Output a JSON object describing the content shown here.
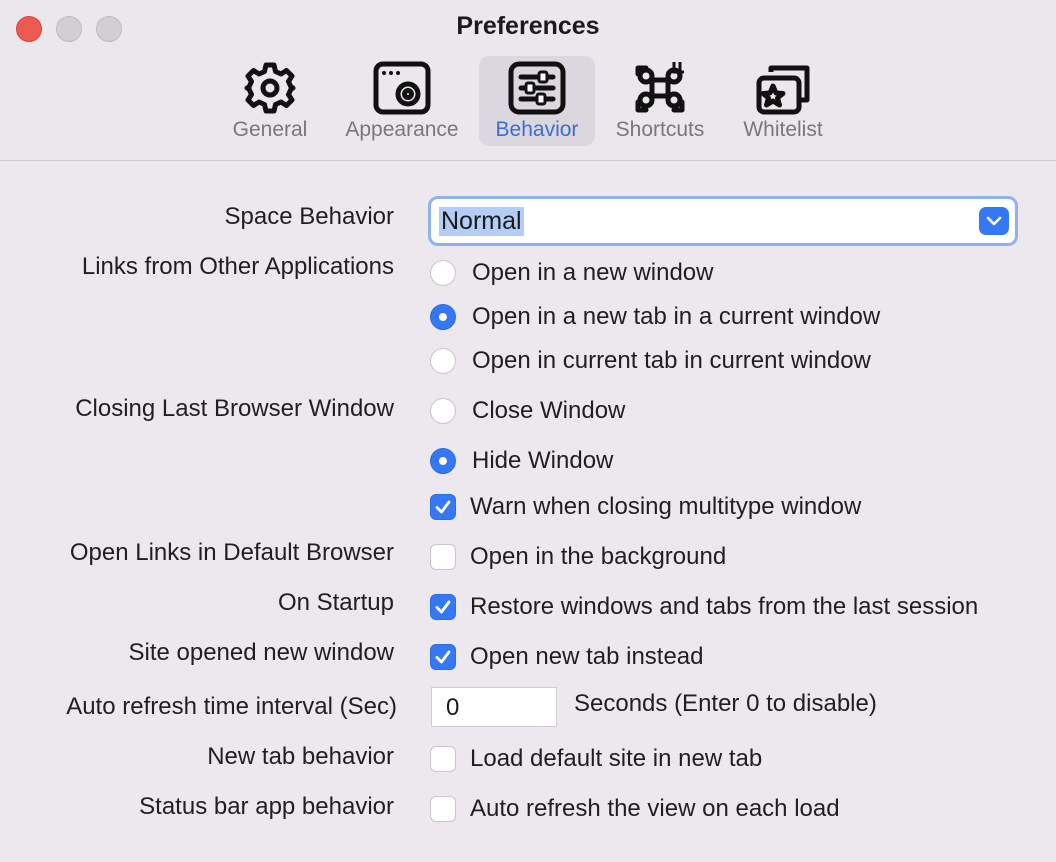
{
  "window": {
    "title": "Preferences"
  },
  "tabs": [
    {
      "label": "General",
      "icon": "gear-icon"
    },
    {
      "label": "Appearance",
      "icon": "window-gear-icon"
    },
    {
      "label": "Behavior",
      "icon": "sliders-icon",
      "active": true
    },
    {
      "label": "Shortcuts",
      "icon": "command-key-icon"
    },
    {
      "label": "Whitelist",
      "icon": "star-windows-icon"
    }
  ],
  "colors": {
    "accent": "#3478f6",
    "active_tab_label": "#3a6fd0",
    "close_button": "#ee5a52"
  },
  "settings": {
    "space_behavior": {
      "label": "Space Behavior",
      "selected": "Normal"
    },
    "links_from_other_apps": {
      "label": "Links from Other Applications",
      "options": [
        {
          "label": "Open in a new window",
          "selected": false
        },
        {
          "label": "Open in a new tab in a current window",
          "selected": true
        },
        {
          "label": "Open in current tab in current window",
          "selected": false
        }
      ]
    },
    "closing_last_window": {
      "label": "Closing Last Browser Window",
      "options": [
        {
          "label": "Close Window",
          "selected": false
        },
        {
          "label": "Hide Window",
          "selected": true
        }
      ],
      "warn": {
        "label": "Warn when closing multitype window",
        "checked": true
      }
    },
    "open_links_default_browser": {
      "label": "Open Links in Default Browser",
      "option": "Open in the background",
      "checked": false
    },
    "on_startup": {
      "label": "On Startup",
      "option": "Restore windows and tabs from the last session",
      "checked": true
    },
    "site_opened_new_window": {
      "label": "Site opened new window",
      "option": "Open new tab instead",
      "checked": true
    },
    "auto_refresh": {
      "label": "Auto refresh time interval (Sec)",
      "value": "0",
      "hint": "Seconds (Enter 0 to disable)"
    },
    "new_tab_behavior": {
      "label": "New tab behavior",
      "option": "Load default site in new tab",
      "checked": false
    },
    "status_bar_behavior": {
      "label": "Status bar app behavior",
      "option": "Auto refresh the view on each load",
      "checked": false
    }
  }
}
